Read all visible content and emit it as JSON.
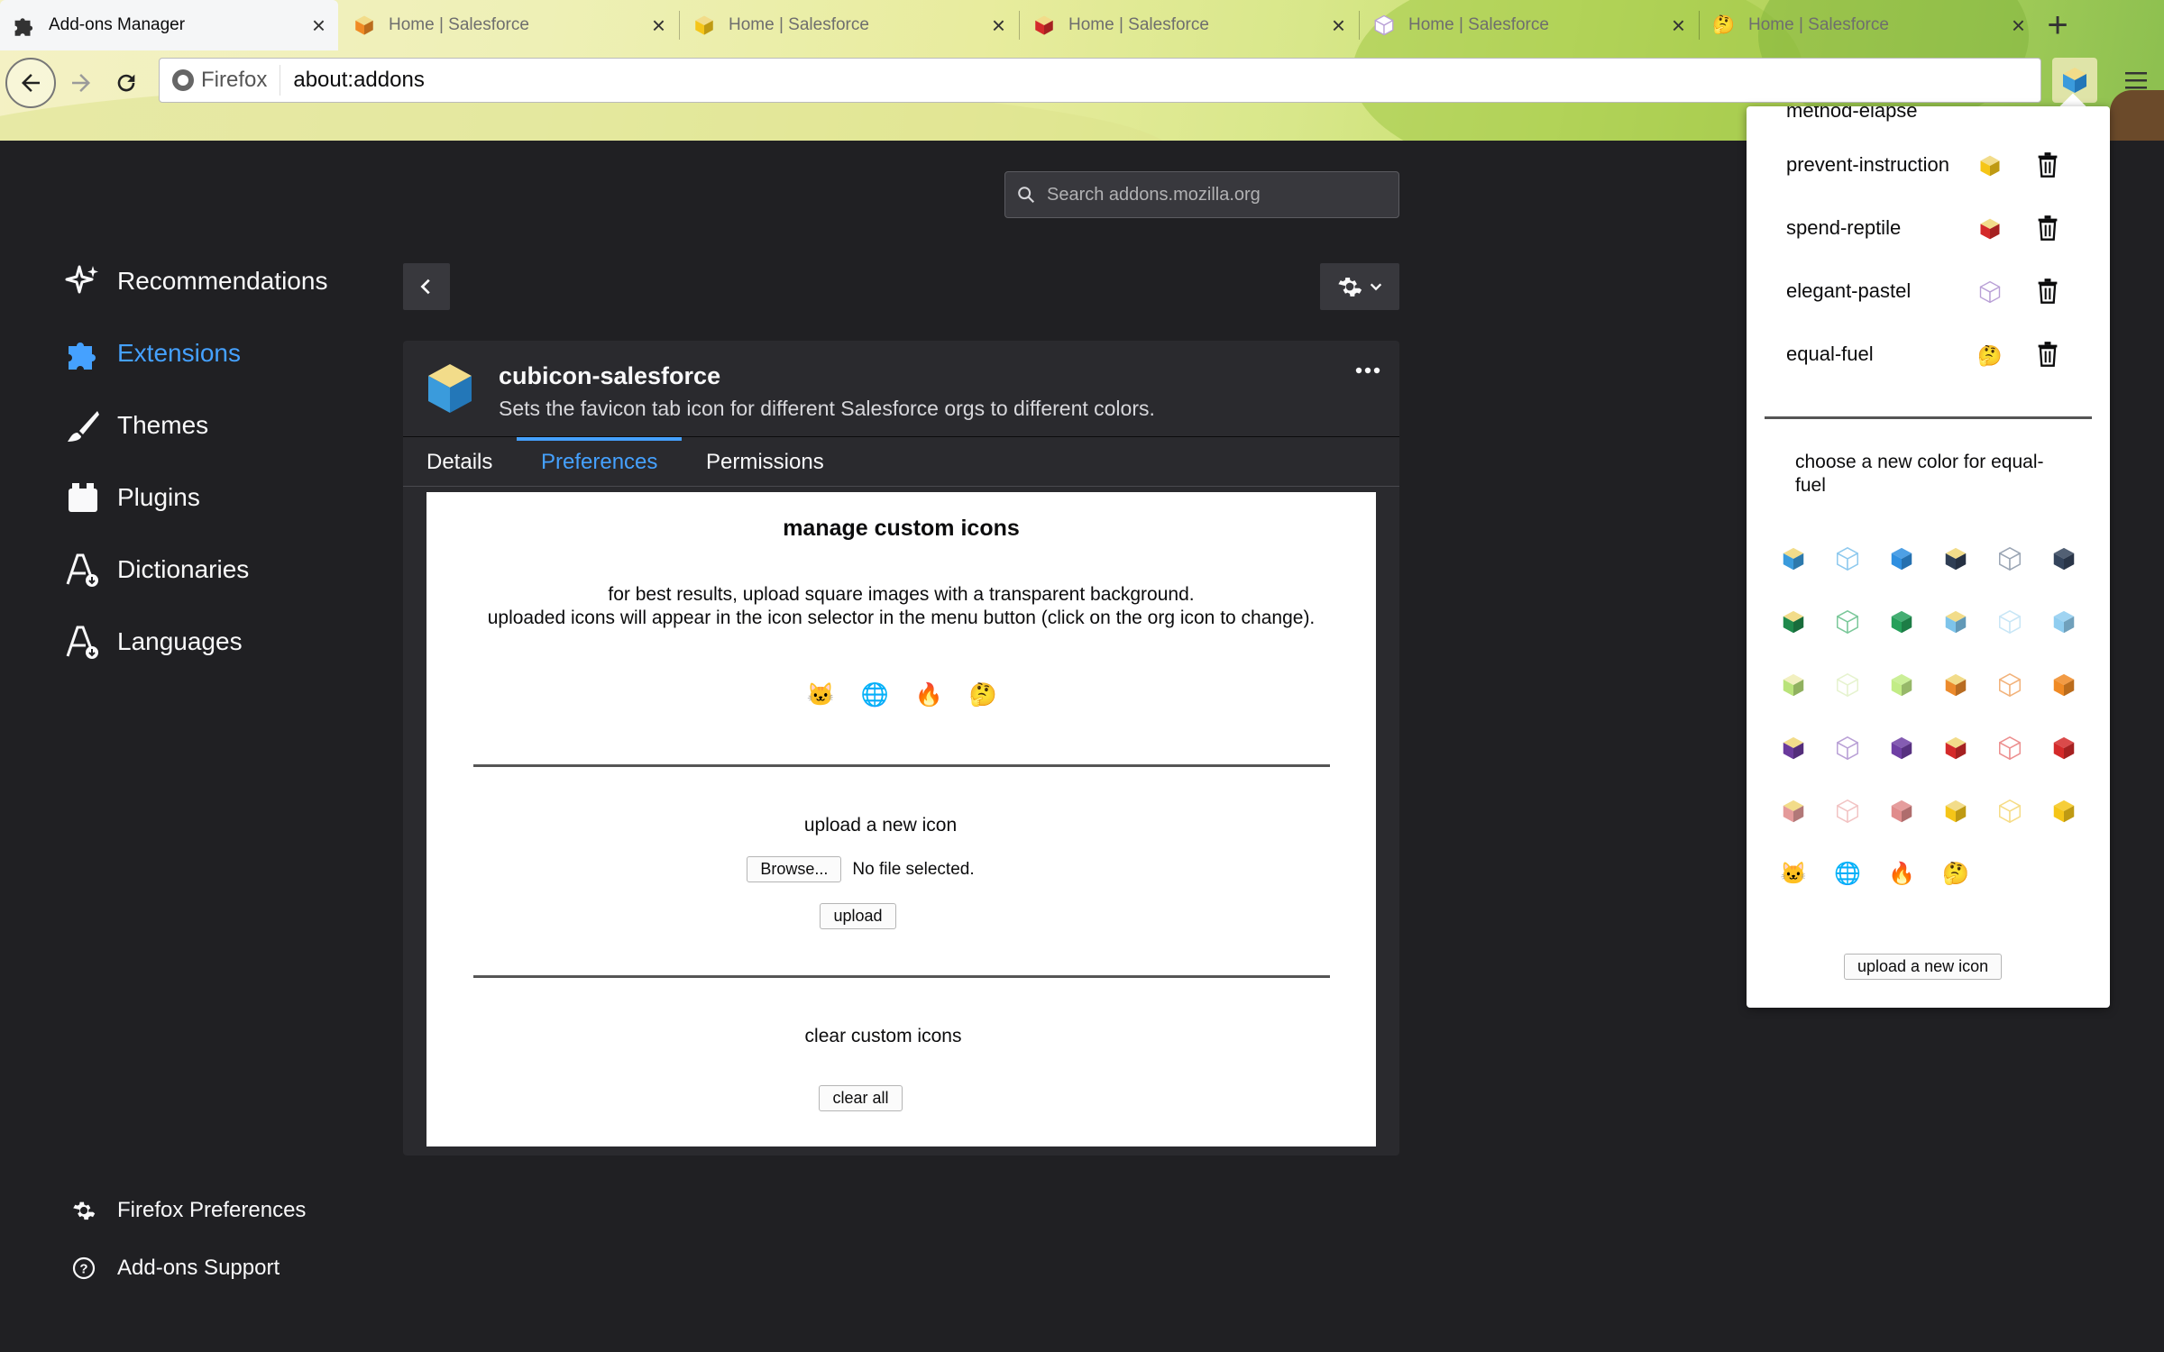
{
  "tabs": [
    {
      "title": "Add-ons Manager",
      "active": true,
      "favicon": "puzzle-icon"
    },
    {
      "title": "Home | Salesforce",
      "active": false,
      "favicon": "cube-orange-icon",
      "color": "#f08a24"
    },
    {
      "title": "Home | Salesforce",
      "active": false,
      "favicon": "cube-yellow-icon",
      "color": "#f5c518"
    },
    {
      "title": "Home | Salesforce",
      "active": false,
      "favicon": "cube-red-icon",
      "color": "#d42a2a"
    },
    {
      "title": "Home | Salesforce",
      "active": false,
      "favicon": "cube-outline-lilac-icon",
      "color": "#b9a0d6"
    },
    {
      "title": "Home | Salesforce",
      "active": false,
      "favicon": "emoji-face-icon",
      "emoji": "🤔"
    }
  ],
  "urlbar": {
    "identity_label": "Firefox",
    "url": "about:addons"
  },
  "sidebar": {
    "categories": [
      {
        "label": "Recommendations",
        "icon": "sparkle-icon"
      },
      {
        "label": "Extensions",
        "icon": "puzzle-icon",
        "active": true
      },
      {
        "label": "Themes",
        "icon": "brush-icon"
      },
      {
        "label": "Plugins",
        "icon": "plugin-icon"
      },
      {
        "label": "Dictionaries",
        "icon": "dictionary-icon"
      },
      {
        "label": "Languages",
        "icon": "language-icon"
      }
    ],
    "footer": [
      {
        "label": "Firefox Preferences",
        "icon": "gear-icon"
      },
      {
        "label": "Add-ons Support",
        "icon": "help-icon"
      }
    ]
  },
  "search": {
    "placeholder": "Search addons.mozilla.org"
  },
  "addon": {
    "name": "cubicon-salesforce",
    "description": "Sets the favicon tab icon for different Salesforce orgs to different colors.",
    "tabs": [
      "Details",
      "Preferences",
      "Permissions"
    ],
    "active_tab": "Preferences"
  },
  "prefs": {
    "title": "manage custom icons",
    "hint_line1": "for best results, upload square images with a transparent background.",
    "hint_line2": "uploaded icons will appear in the icon selector in the menu button (click on the org icon to change).",
    "custom_icons": [
      "🐱",
      "🌐",
      "🔥",
      "🤔"
    ],
    "upload_heading": "upload a new icon",
    "browse_label": "Browse...",
    "file_status": "No file selected.",
    "upload_label": "upload",
    "clear_heading": "clear custom icons",
    "clear_label": "clear all"
  },
  "popup": {
    "partial_org": "method-elapse",
    "orgs": [
      {
        "name": "prevent-instruction",
        "icon": "cube-yellow",
        "color": "#f5c518"
      },
      {
        "name": "spend-reptile",
        "icon": "cube-red",
        "color": "#d42a2a"
      },
      {
        "name": "elegant-pastel",
        "icon": "cube-outline-lilac",
        "color": "#b9a0d6"
      },
      {
        "name": "equal-fuel",
        "icon": "emoji-face",
        "emoji": "🤔"
      }
    ],
    "choose_label": "choose a new color for equal-fuel",
    "swatch_rows": [
      [
        {
          "style": "solid-top",
          "color": "#3a9bdc",
          "top": "#f2dc8a"
        },
        {
          "style": "outline",
          "color": "#8ec9ee"
        },
        {
          "style": "solid",
          "color": "#2f8fe0"
        },
        {
          "style": "solid-top",
          "color": "#2f3e54",
          "top": "#f2dc8a"
        },
        {
          "style": "outline",
          "color": "#9aa5b4"
        },
        {
          "style": "solid",
          "color": "#34445c"
        }
      ],
      [
        {
          "style": "solid-top",
          "color": "#1f8a4c",
          "top": "#f2dc8a"
        },
        {
          "style": "outline",
          "color": "#7bc89a"
        },
        {
          "style": "solid",
          "color": "#25a05a"
        },
        {
          "style": "solid-top",
          "color": "#7ec4ea",
          "top": "#f2dc8a"
        },
        {
          "style": "outline",
          "color": "#c8e6f6"
        },
        {
          "style": "solid",
          "color": "#8fcdf0"
        }
      ],
      [
        {
          "style": "solid-top",
          "color": "#b9e37a",
          "top": "#f2f0c0"
        },
        {
          "style": "outline",
          "color": "#e6f3cf"
        },
        {
          "style": "solid",
          "color": "#c2ec86"
        },
        {
          "style": "solid-top",
          "color": "#ec8a2c",
          "top": "#f2dc8a"
        },
        {
          "style": "outline",
          "color": "#f2b27a"
        },
        {
          "style": "solid",
          "color": "#f08a24"
        }
      ],
      [
        {
          "style": "solid-top",
          "color": "#6a3a9c",
          "top": "#f2dc8a"
        },
        {
          "style": "outline",
          "color": "#b9a0d6"
        },
        {
          "style": "solid",
          "color": "#6f3fa4"
        },
        {
          "style": "solid-top",
          "color": "#d42a2a",
          "top": "#f2dc8a"
        },
        {
          "style": "outline",
          "color": "#ec8f8f"
        },
        {
          "style": "solid",
          "color": "#d42a2a"
        }
      ],
      [
        {
          "style": "solid-top",
          "color": "#e49a9a",
          "top": "#f2dc8a"
        },
        {
          "style": "outline",
          "color": "#f2c4c4"
        },
        {
          "style": "solid",
          "color": "#e08c8c"
        },
        {
          "style": "solid-top",
          "color": "#f5c518",
          "top": "#f2dc8a"
        },
        {
          "style": "outline",
          "color": "#f6dc86"
        },
        {
          "style": "solid",
          "color": "#f5c518"
        }
      ],
      [
        {
          "style": "emoji",
          "emoji": "🐱"
        },
        {
          "style": "emoji",
          "emoji": "🌐"
        },
        {
          "style": "emoji",
          "emoji": "🔥"
        },
        {
          "style": "emoji",
          "emoji": "🤔"
        }
      ]
    ],
    "upload_new_label": "upload a new icon"
  },
  "colors": {
    "accent": "#45a1ff",
    "page_background": "#202023",
    "card_background": "#2a2a2e"
  }
}
